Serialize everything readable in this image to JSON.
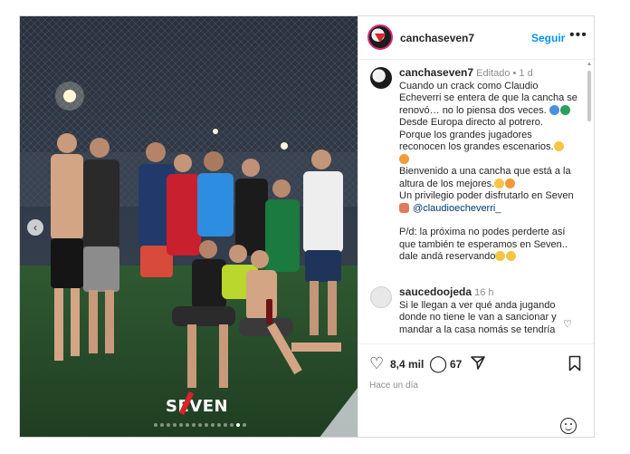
{
  "post": {
    "username": "canchaseven7",
    "follow_label": "Seguir",
    "more_label": "•••"
  },
  "caption": {
    "username": "canchaseven7",
    "meta": "Editado • 1 d",
    "lines": [
      "Cuando un crack como Claudio",
      "Echeverri se entera de que la cancha se",
      "renovó… no lo piensa dos veces.",
      "Desde Europa directo al potrero.",
      "Porque los grandes jugadores",
      "reconocen los grandes escenarios.",
      "",
      "Bienvenido a una cancha que está a la",
      "altura de los mejores.",
      "Un privilegio poder disfrutarlo en Seven",
      "@claudioecheverri_",
      "P/d: la próxima no podes perderte así",
      "que también te esperamos en Seven..",
      "dale andá reservando"
    ]
  },
  "comment": {
    "username": "saucedoojeda",
    "meta": "16 h",
    "text": "Si le llegan a ver qué anda jugando donde no tiene le van a sancionar y mandar a la casa nomás se tendría"
  },
  "actions": {
    "likes": "8,4 mil",
    "comments": "67",
    "time_ago": "Hace un día"
  },
  "photo": {
    "watermark": "SEVEN",
    "carousel_prev": "‹"
  },
  "colors": {
    "accent": "#0095f6",
    "mention": "#00376b",
    "muted": "#8e8e8e"
  }
}
